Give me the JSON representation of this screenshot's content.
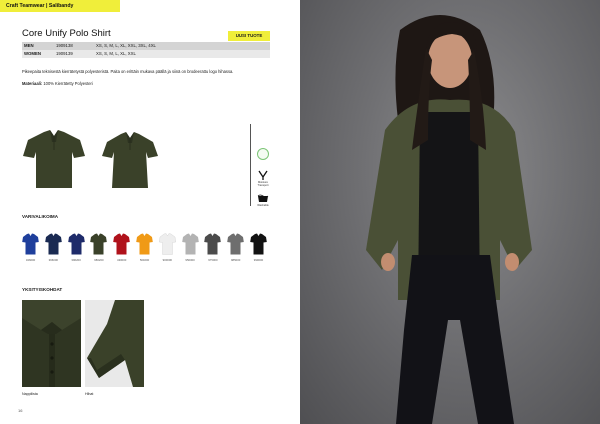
{
  "header": {
    "brand_tab": "Craft Teamwear | Salibandy"
  },
  "product": {
    "title": "Core Unify Polo Shirt",
    "new_badge": "UUSI TUOTE",
    "sizes": [
      {
        "gender": "MEN",
        "code": "1909138",
        "sizes": "XS, S, M, L, XL, XXL, 3XL, 4XL"
      },
      {
        "gender": "WOMEN",
        "code": "1909139",
        "sizes": "XS, S, M, L, XL, XXL"
      }
    ],
    "description": "Pikeepaita teknisestä kierrätetystä polyesteristä. Paita on erittäin mukava päällä ja siinä on brodeerattu logo hihassa.",
    "material_label": "Materiaali:",
    "material_value": "100% Kierrätetty Polyesteri"
  },
  "color_section": {
    "label": "VARIVALIKOIMA",
    "swatches": [
      {
        "code": "346000",
        "color": "#1f3f9c"
      },
      {
        "code": "396000",
        "color": "#1a2a52"
      },
      {
        "code": "396200",
        "color": "#1e2b6a"
      },
      {
        "code": "686200",
        "color": "#3a4129"
      },
      {
        "code": "430000",
        "color": "#b0121b"
      },
      {
        "code": "564000",
        "color": "#f09a16"
      },
      {
        "code": "900000",
        "color": "#eeeeee"
      },
      {
        "code": "950000",
        "color": "#b3b3b3"
      },
      {
        "code": "975000",
        "color": "#4b4b4b"
      },
      {
        "code": "985000",
        "color": "#6e6e6e"
      },
      {
        "code": "999000",
        "color": "#121212"
      }
    ]
  },
  "details_section": {
    "label": "YKSITYISKOHDAT",
    "items": [
      {
        "caption": "Nappilista"
      },
      {
        "caption": "Hihat"
      }
    ]
  },
  "feature_icons": [
    {
      "name": "recycled-icon",
      "caption": ""
    },
    {
      "name": "moisture-wicking-icon",
      "caption": "Moisture Transport"
    },
    {
      "name": "wash-icon",
      "caption": "Washable"
    }
  ],
  "page_number": "16",
  "colors": {
    "accent": "#f0ee3a",
    "product": "#3a4129"
  }
}
